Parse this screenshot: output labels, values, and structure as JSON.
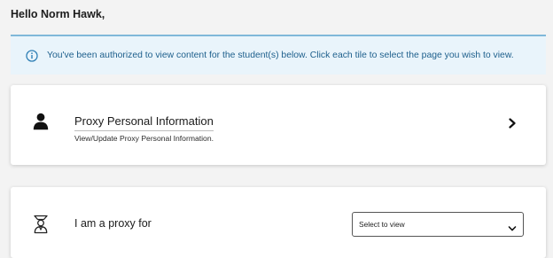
{
  "greeting": "Hello Norm Hawk,",
  "info_banner": {
    "icon": "info-icon",
    "text": "You've been authorized to view content for the student(s) below. Click each tile to select the page you wish to view."
  },
  "proxy_personal_info_card": {
    "icon": "person-icon",
    "title": "Proxy Personal Information",
    "subtitle": "View/Update Proxy Personal Information.",
    "action_icon": "chevron-right-icon"
  },
  "proxy_for_card": {
    "icon": "student-icon",
    "label": "I am a proxy for",
    "select": {
      "selected": "Select to view",
      "icon": "chevron-down-icon"
    }
  },
  "colors": {
    "page_bg": "#f3f3f3",
    "banner_bg": "#e9f4fb",
    "banner_text": "#1d5f8c",
    "banner_border": "#7fb8d9"
  }
}
